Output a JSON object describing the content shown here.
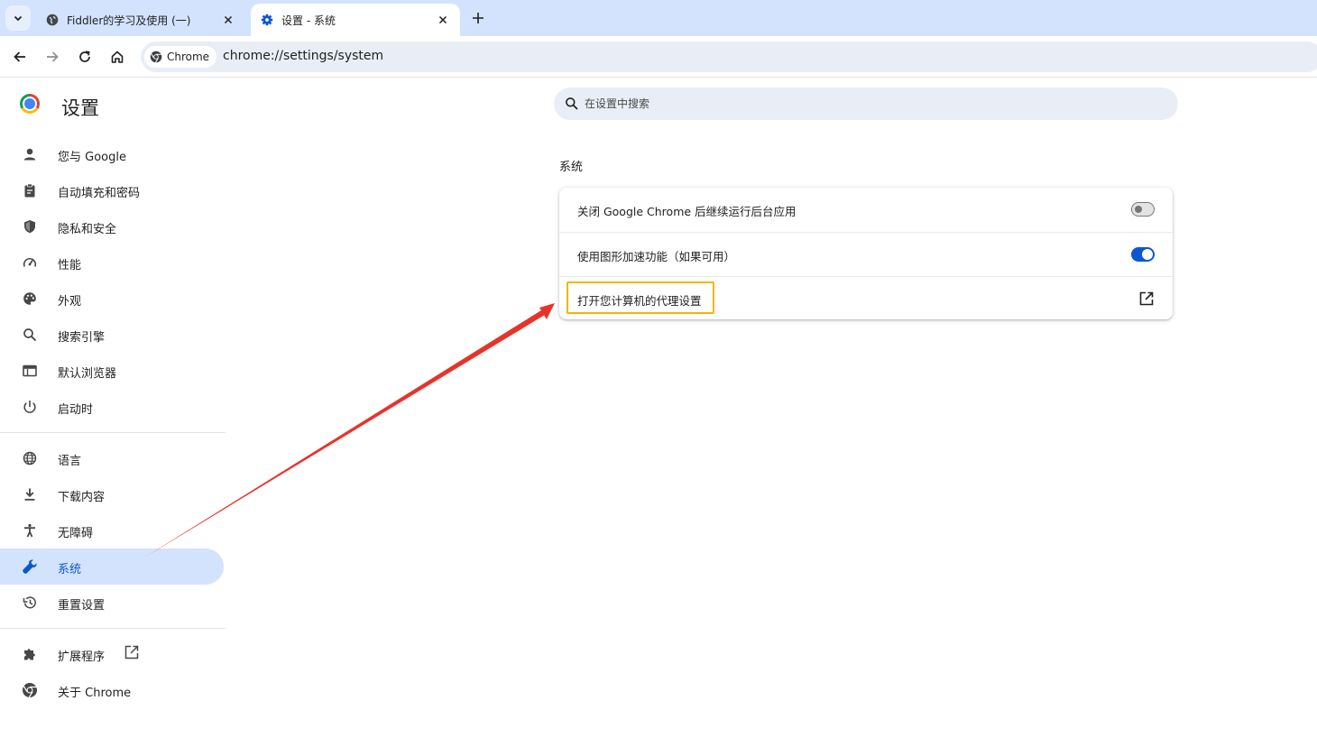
{
  "browser": {
    "tabs": [
      {
        "title": "Fiddler的学习及使用 (一)",
        "favicon": "globe-icon",
        "active": false
      },
      {
        "title": "设置 - 系统",
        "favicon": "gear-icon",
        "active": true
      }
    ],
    "omnibox": {
      "chip_label": "Chrome",
      "url": "chrome://settings/system"
    }
  },
  "sidebar": {
    "title": "设置",
    "groups": [
      [
        {
          "label": "您与 Google",
          "icon": "person-icon"
        },
        {
          "label": "自动填充和密码",
          "icon": "clipboard-icon"
        },
        {
          "label": "隐私和安全",
          "icon": "shield-icon"
        },
        {
          "label": "性能",
          "icon": "speedometer-icon"
        },
        {
          "label": "外观",
          "icon": "palette-icon"
        },
        {
          "label": "搜索引擎",
          "icon": "search-icon"
        },
        {
          "label": "默认浏览器",
          "icon": "browser-icon"
        },
        {
          "label": "启动时",
          "icon": "power-icon"
        }
      ],
      [
        {
          "label": "语言",
          "icon": "globe-icon"
        },
        {
          "label": "下载内容",
          "icon": "download-icon"
        },
        {
          "label": "无障碍",
          "icon": "accessibility-icon"
        },
        {
          "label": "系统",
          "icon": "wrench-icon",
          "active": true
        },
        {
          "label": "重置设置",
          "icon": "history-icon"
        }
      ],
      [
        {
          "label": "扩展程序",
          "icon": "puzzle-icon"
        },
        {
          "label": "关于 Chrome",
          "icon": "chrome-icon"
        }
      ]
    ]
  },
  "main": {
    "search": {
      "placeholder": "在设置中搜索",
      "value": ""
    },
    "section_title": "系统",
    "rows": [
      {
        "label": "关闭 Google Chrome 后继续运行后台应用",
        "control": "toggle",
        "value": false
      },
      {
        "label": "使用图形加速功能（如果可用）",
        "control": "toggle",
        "value": true
      },
      {
        "label": "打开您计算机的代理设置",
        "control": "external-link"
      }
    ]
  },
  "colors": {
    "accent": "#0b57d0",
    "active_nav_bg": "#d3e3fd",
    "highlight_box": "#f5b400",
    "annotation_arrow": "#e8332a"
  }
}
